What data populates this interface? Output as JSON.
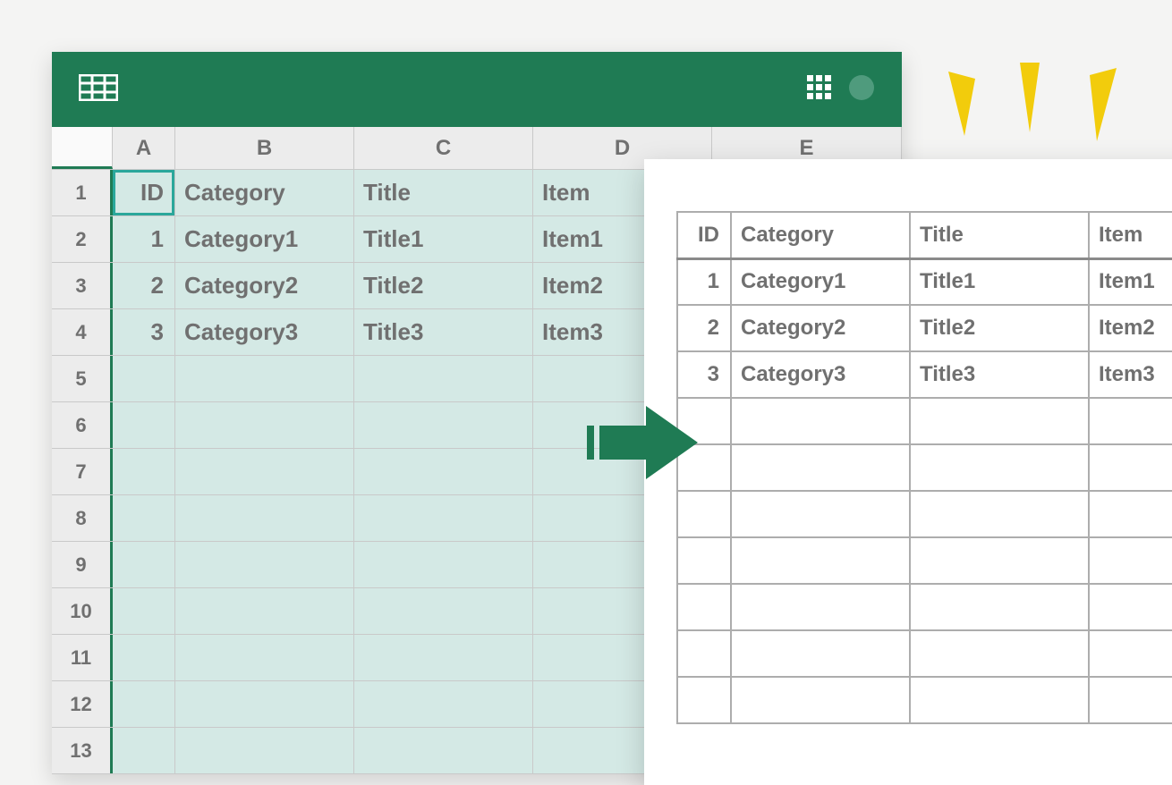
{
  "columns": [
    "A",
    "B",
    "C",
    "D",
    "E"
  ],
  "row_numbers": [
    1,
    2,
    3,
    4,
    5,
    6,
    7,
    8,
    9,
    10,
    11,
    12,
    13
  ],
  "headers": {
    "id": "ID",
    "category": "Category",
    "title": "Title",
    "item": "Item"
  },
  "rows": [
    {
      "id": "1",
      "category": "Category1",
      "title": "Title1",
      "item": "Item1"
    },
    {
      "id": "2",
      "category": "Category2",
      "title": "Title2",
      "item": "Item2"
    },
    {
      "id": "3",
      "category": "Category3",
      "title": "Title3",
      "item": "Item3"
    }
  ],
  "export": {
    "headers": {
      "id": "ID",
      "category": "Category",
      "title": "Title",
      "item": "Item"
    },
    "rows": [
      {
        "id": "1",
        "category": "Category1",
        "title": "Title1",
        "item": "Item1"
      },
      {
        "id": "2",
        "category": "Category2",
        "title": "Title2",
        "item": "Item2"
      },
      {
        "id": "3",
        "category": "Category3",
        "title": "Title3",
        "item": "Item3"
      }
    ],
    "empty_row_count": 7
  },
  "colors": {
    "brand": "#1f7b54",
    "selection": "#d4e9e5",
    "accent": "#f2cc0c"
  }
}
